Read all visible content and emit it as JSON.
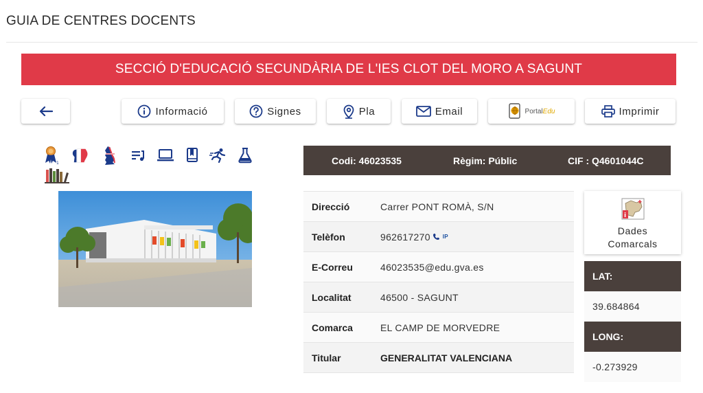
{
  "page": {
    "title": "GUIA DE CENTRES DOCENTS"
  },
  "banner": {
    "school_name": "SECCIÓ D'EDUCACIÓ SECUNDÀRIA DE L'IES CLOT DEL MORO A SAGUNT",
    "color": "#e03a48"
  },
  "toolbar": {
    "back_icon": "arrow-left-icon",
    "buttons": [
      {
        "label": "Informació",
        "icon": "info-circle-icon"
      },
      {
        "label": "Signes",
        "icon": "question-circle-icon"
      },
      {
        "label": "Pla",
        "icon": "map-pin-icon"
      },
      {
        "label": "Email",
        "icon": "envelope-icon"
      },
      {
        "label": "PortalEdu",
        "icon": "portaledu-logo"
      },
      {
        "label": "Imprimir",
        "icon": "printer-icon"
      }
    ]
  },
  "feature_icons": [
    "award-icon",
    "french-flag-icon",
    "english-flag-icon",
    "music-icon",
    "laptop-icon",
    "book-icon",
    "sports-icon",
    "flask-icon",
    "library-books-icon"
  ],
  "info_bar": {
    "codi": "Codi: 46023535",
    "regim": "Règim: Públic",
    "cif": "CIF : Q4601044C",
    "color": "#4a403c"
  },
  "details": [
    {
      "label": "Direcció",
      "value": "Carrer PONT ROMÀ, S/N"
    },
    {
      "label": "Telèfon",
      "value": "962617270",
      "badge": "IP"
    },
    {
      "label": "E-Correu",
      "value": "46023535@edu.gva.es"
    },
    {
      "label": "Localitat",
      "value": "46500 - SAGUNT"
    },
    {
      "label": "Comarca",
      "value": "EL CAMP DE MORVEDRE"
    },
    {
      "label": "Titular",
      "value": "GENERALITAT VALENCIANA"
    }
  ],
  "comarcal": {
    "line1": "Dades",
    "line2": "Comarcals",
    "icon": "comarca-map-icon"
  },
  "coords": {
    "lat_label": "LAT:",
    "lat_value": "39.684864",
    "long_label": "LONG:",
    "long_value": "-0.273929"
  }
}
